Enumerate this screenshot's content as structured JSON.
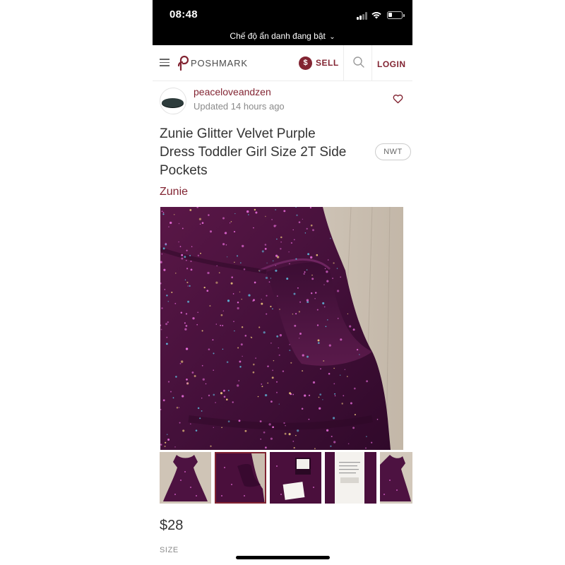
{
  "status_bar": {
    "time": "08:48",
    "incognito_text": "Chế độ ẩn danh đang bật",
    "incognito_chevron": "⌄",
    "icons": [
      "cellular-signal-icon",
      "wifi-icon",
      "battery-icon"
    ],
    "battery_level": 0.3
  },
  "header": {
    "logo_text": "POSHMARK",
    "sell_symbol": "$",
    "sell_label": "SELL",
    "login_label": "LOGIN",
    "icons": [
      "hamburger-menu-icon",
      "poshmark-logo-icon",
      "search-icon"
    ]
  },
  "seller": {
    "username": "peaceloveandzen",
    "updated": "Updated 14 hours ago",
    "like_icon": "heart-icon"
  },
  "listing": {
    "title": "Zunie Glitter Velvet Purple Dress Toddler Girl Size 2T Side Pockets",
    "condition_badge": "NWT",
    "brand": "Zunie",
    "price": "$28",
    "size_label": "SIZE",
    "main_photo": "purple glitter velvet dress close-up with side pocket",
    "thumbnails": [
      {
        "name": "dress-front",
        "selected": false
      },
      {
        "name": "pocket-closeup",
        "selected": true
      },
      {
        "name": "neck-label",
        "selected": false
      },
      {
        "name": "care-tag",
        "selected": false
      },
      {
        "name": "dress-side",
        "selected": false
      }
    ]
  },
  "colors": {
    "accent": "#822432",
    "dress_purple": "#4a0f3c",
    "glitter_pink": "#e36ad6",
    "glitter_blue": "#5fb5d9",
    "glitter_gold": "#e9c27a"
  }
}
